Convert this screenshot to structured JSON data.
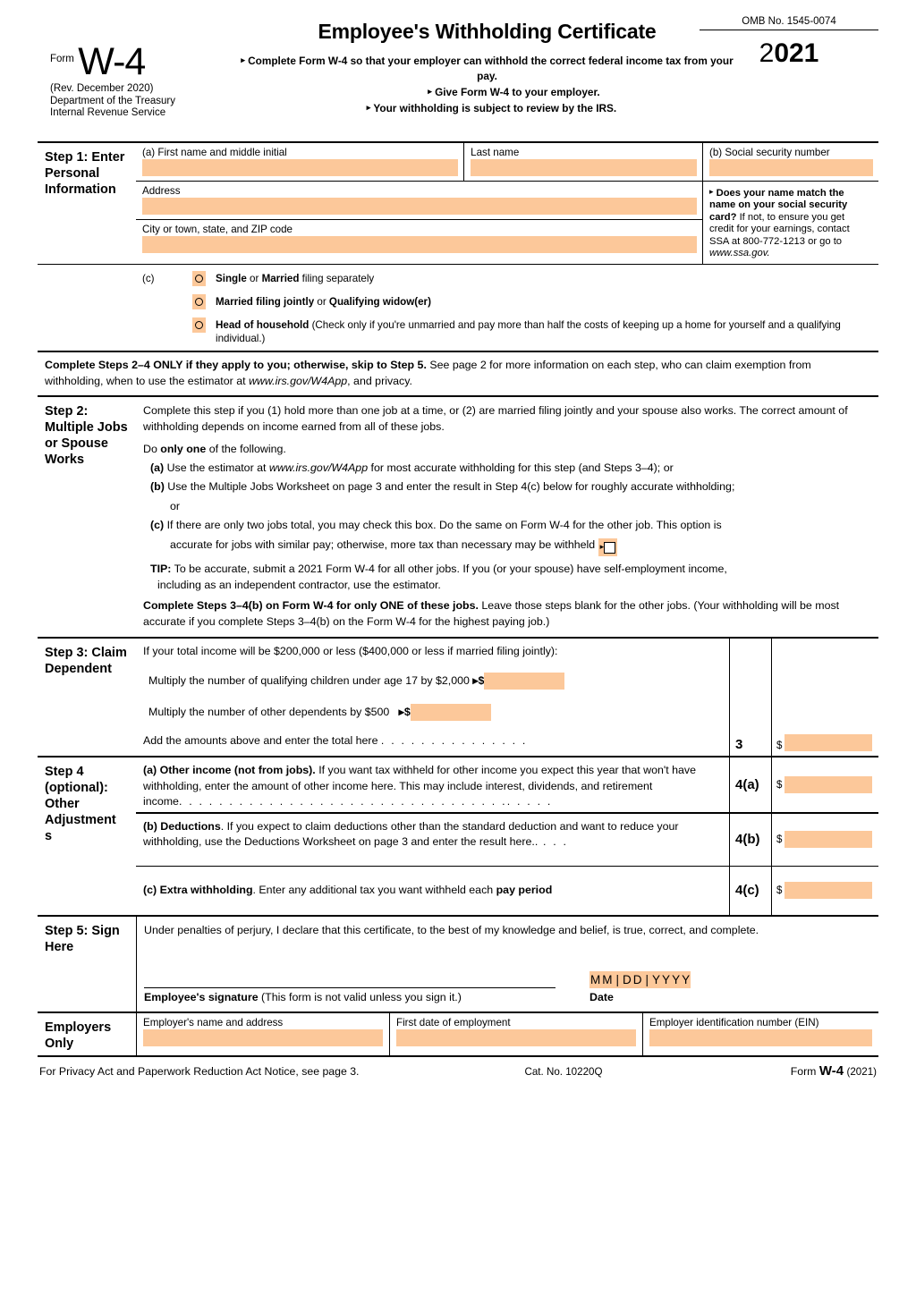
{
  "header": {
    "form_word": "Form",
    "form_number": "W-4",
    "revision": "(Rev. December 2020)",
    "department": "Department of the Treasury",
    "service": "Internal Revenue Service",
    "title": "Employee's Withholding Certificate",
    "sub_line_1": "Complete Form W-4 so that your employer can withhold the correct federal income tax from your pay.",
    "sub_line_2": "Give Form W-4 to your employer.",
    "sub_line_3": "Your withholding is subject to review by the IRS.",
    "omb": "OMB No. 1545-0074",
    "year_light": "2",
    "year_bold": "021",
    "arrow": "▸"
  },
  "step1": {
    "label": "Step 1: Enter Personal Information",
    "first_name_label": "(a) First name and middle initial",
    "last_name_label": "Last name",
    "ssn_label": "(b) Social security number",
    "address_label": "Address",
    "city_label": "City or town, state, and ZIP code",
    "ssn_note_bold": "Does your name match the name on your social security card?",
    "ssn_note_rest": " If not, to ensure you get credit for your earnings, contact SSA at 800-772-1213 or go to ",
    "ssn_note_link": "www.ssa.gov.",
    "c_marker": "(c)",
    "options": [
      {
        "bold": "Single",
        "mid": " or ",
        "bold2": "Married",
        "rest": " filing separately"
      },
      {
        "bold": "Married filing jointly",
        "mid": " or ",
        "bold2": "Qualifying widow(er)",
        "rest": ""
      },
      {
        "bold": "Head of household",
        "mid": "",
        "bold2": "",
        "rest": " (Check only if you're unmarried and pay more than half the costs of keeping up a home for yourself and a qualifying individual.)"
      }
    ]
  },
  "notice": {
    "bold": "Complete Steps 2–4 ONLY if they apply to you; otherwise, skip to Step 5.",
    "rest1": " See page 2 for more information on each step, who can claim exemption from withholding, when to use the estimator at ",
    "link": "www.irs.gov/W4App",
    "rest2": ", and privacy."
  },
  "step2": {
    "label": "Step 2: Multiple Jobs or Spouse Works",
    "intro": "Complete this step if you (1) hold more than one job at a time, or (2) are married filing jointly and your spouse also works. The correct amount of withholding depends on income earned from all of these jobs.",
    "do_only_pre": "Do ",
    "do_only_bold": "only one",
    "do_only_post": " of the following.",
    "item_a_label": "(a)",
    "item_a_pre": " Use the estimator at ",
    "item_a_link": "www.irs.gov/W4App",
    "item_a_post": " for most accurate withholding for this step (and Steps 3–4); or",
    "item_b_label": "(b)",
    "item_b_text": " Use the Multiple Jobs Worksheet on page 3 and enter the result in Step 4(c) below for roughly accurate withholding;",
    "item_b_cont": "or",
    "item_c_label": "(c)",
    "item_c_text": " If there are only two jobs total, you may check this box. Do the same on Form W-4 for the other job. This option is",
    "item_c_line2": "accurate for jobs with similar pay; otherwise, more tax than necessary may be withheld",
    "tip_label": "TIP:",
    "tip_text": " To be accurate, submit a 2021 Form W-4 for all other jobs. If you (or your spouse) have self-employment income,",
    "tip_text2": "including as an independent contractor, use the estimator.",
    "closing_bold": "Complete Steps 3–4(b) on Form W-4 for only ONE of these jobs.",
    "closing_rest": " Leave those steps blank for the other jobs. (Your withholding will be most accurate if you complete Steps 3–4(b) on the Form W-4 for the highest paying job.)"
  },
  "step3": {
    "label": "Step 3: Claim Dependent",
    "intro": "If your total income will be $200,000 or less ($400,000 or less if married filing jointly):",
    "line1": "Multiply the number of qualifying children under age 17 by $2,000",
    "line2": "Multiply the number of other dependents by $500",
    "total_line": "Add the amounts above and enter the total here",
    "dots": ".  .  .  .  .  .  .  .  .  .  .  .  .  .  .",
    "row_number": "3",
    "dollar": "$",
    "arrow_dollar": "▸$"
  },
  "step4": {
    "label_line1": "Step 4",
    "label_line2": "(optional):",
    "label_line3": "Other",
    "label_line4": "Adjustment",
    "label_line5": "s",
    "a_bold": "(a) Other income (not from jobs).",
    "a_text": " If you want tax withheld for other income you expect  this year that won't have withholding, enter the amount of other income here. This may include interest, dividends, and retirement",
    "a_text2": "income",
    "a_dots": ". . . . . . . . . . . . . . . . . . . . . . . . . . . . . . . . .. . . . .",
    "a_number": "4(a)",
    "b_bold": "(b) Deductions",
    "b_text": ". If you expect to claim deductions other than the standard deduction and want to reduce your withholding, use the Deductions Worksheet on page 3 and enter the result here..",
    "b_dots": " . . .",
    "b_number": "4(b)",
    "c_bold": "(c) Extra withholding",
    "c_text": ". Enter any additional tax you want withheld each ",
    "c_bold2": "pay period",
    "c_number": "4(c)",
    "dollar": "$"
  },
  "step5": {
    "label": "Step 5: Sign Here",
    "perjury": "Under penalties of perjury, I declare that this certificate, to the best of my knowledge and belief, is true, correct, and complete.",
    "signature_bold": "Employee's signature",
    "signature_rest": " (This form is not valid unless you sign it.)",
    "date_mask": [
      "M",
      "M",
      "|",
      "D",
      "D",
      "|",
      "Y",
      "Y",
      "Y",
      "Y"
    ],
    "date_label": "Date"
  },
  "employers": {
    "label_line1": "Employers",
    "label_line2": "Only",
    "name_address_label": "Employer's name and address",
    "first_date_label": "First date of employment",
    "ein_label": "Employer identification number (EIN)"
  },
  "footer": {
    "privacy": "For Privacy Act and Paperwork Reduction Act Notice, see page 3.",
    "cat_no": "Cat. No. 10220Q",
    "form_word": "Form",
    "form_number": "W-4",
    "year": "(2021)"
  },
  "colors": {
    "fill": "#fcc89a",
    "rule": "#000000"
  }
}
